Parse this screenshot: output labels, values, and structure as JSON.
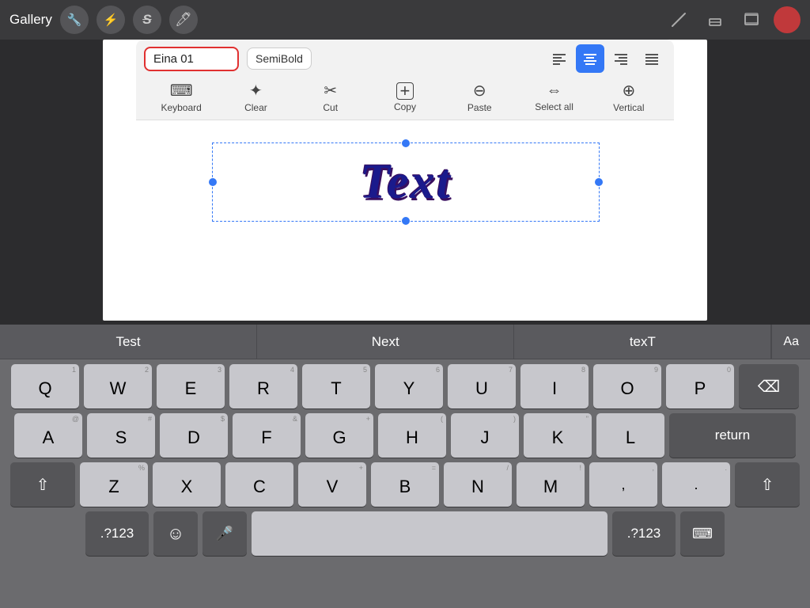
{
  "topbar": {
    "gallery_label": "Gallery",
    "icons": [
      "wrench",
      "lightning",
      "S-strikethrough",
      "pen"
    ],
    "right_icons": [
      "pencil-line",
      "eraser",
      "layers"
    ]
  },
  "toolbar": {
    "font_name": "Eina 01",
    "font_weight": "SemiBold",
    "align_buttons": [
      {
        "label": "≡",
        "id": "align-left"
      },
      {
        "label": "≡",
        "id": "align-center",
        "active": true
      },
      {
        "label": "≡",
        "id": "align-right"
      },
      {
        "label": "≡",
        "id": "align-justify"
      }
    ],
    "tools": [
      {
        "icon": "⌨",
        "label": "Keyboard"
      },
      {
        "icon": "✦",
        "label": "Clear"
      },
      {
        "icon": "✂",
        "label": "Cut"
      },
      {
        "icon": "+",
        "label": "Copy"
      },
      {
        "icon": "⊖",
        "label": "Paste"
      },
      {
        "icon": "⇔",
        "label": "Select all"
      },
      {
        "icon": "⊕",
        "label": "Vertical"
      }
    ]
  },
  "canvas": {
    "text": "Text"
  },
  "autocorrect": {
    "suggestions": [
      "Test",
      "Next",
      "texT"
    ],
    "aa_label": "Aa"
  },
  "keyboard": {
    "rows": [
      {
        "keys": [
          {
            "letter": "Q",
            "num": "1"
          },
          {
            "letter": "W",
            "num": "2"
          },
          {
            "letter": "E",
            "num": "3"
          },
          {
            "letter": "R",
            "num": "4"
          },
          {
            "letter": "T",
            "num": "5"
          },
          {
            "letter": "Y",
            "num": "6"
          },
          {
            "letter": "U",
            "num": "7"
          },
          {
            "letter": "I",
            "num": "8"
          },
          {
            "letter": "O",
            "num": "9"
          },
          {
            "letter": "P",
            "num": "0"
          }
        ]
      },
      {
        "keys": [
          {
            "letter": "A",
            "num": "@"
          },
          {
            "letter": "S",
            "num": "#"
          },
          {
            "letter": "D",
            "num": "$"
          },
          {
            "letter": "F",
            "num": "&"
          },
          {
            "letter": "G",
            "num": "+"
          },
          {
            "letter": "H",
            "num": "("
          },
          {
            "letter": "J",
            "num": ")"
          },
          {
            "letter": "K",
            "num": "\""
          },
          {
            "letter": "L",
            "num": ""
          }
        ]
      },
      {
        "keys": [
          {
            "letter": "Z",
            "num": "%"
          },
          {
            "letter": "X",
            "num": ""
          },
          {
            "letter": "C",
            "num": ""
          },
          {
            "letter": "V",
            "num": "+"
          },
          {
            "letter": "B",
            "num": "="
          },
          {
            "letter": "N",
            "num": "/"
          },
          {
            "letter": "M",
            "num": "!"
          }
        ]
      }
    ],
    "shift_label": "⇧",
    "backspace_label": "⌫",
    "numbers_label": ".?123",
    "emoji_label": "☺",
    "mic_label": "🎤",
    "space_label": "",
    "return_label": "return",
    "keyboard_icon_label": "⌨",
    "numbers_label2": ".?123"
  }
}
